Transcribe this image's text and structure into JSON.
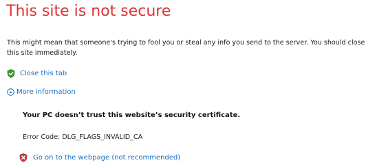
{
  "page": {
    "title": "This site is not secure",
    "description": "This might mean that someone's trying to fool you or steal any info you send to the server. You should close this site immediately."
  },
  "actions": {
    "close_tab_label": "Close this tab",
    "more_info_label": "More information",
    "go_on_label": "Go on to the webpage (not recommended)"
  },
  "details": {
    "trust_message": "Your PC doesn’t trust this website’s security certificate.",
    "error_code": "Error Code: DLG_FLAGS_INVALID_CA"
  },
  "icons": {
    "close_tab": "shield-check-icon",
    "more_info": "circle-chevron-up-icon",
    "go_on": "shield-x-icon"
  },
  "colors": {
    "title": "#dd3333",
    "link": "#1a6fc4",
    "shield_ok": "#3a9b2c",
    "shield_bad": "#d13438"
  }
}
